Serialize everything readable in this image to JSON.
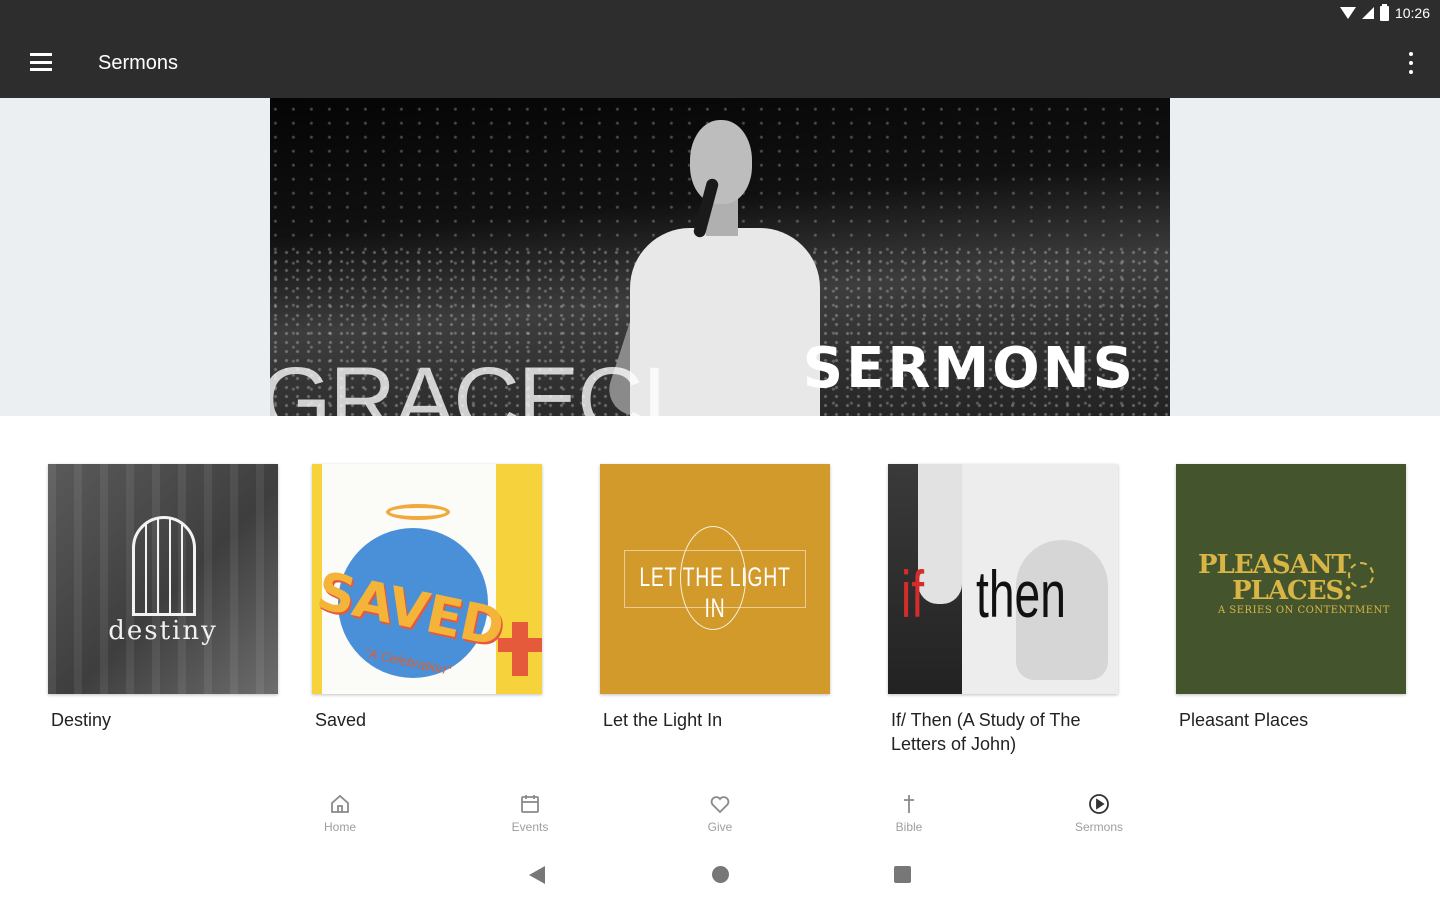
{
  "status_bar": {
    "time": "10:26",
    "icons": [
      "wifi-icon",
      "signal-icon",
      "battery-icon"
    ]
  },
  "app_bar": {
    "title": "Sermons",
    "left_icon": "menu-icon",
    "right_icon": "more-vert-icon",
    "background": "#2d2d2d"
  },
  "hero": {
    "label": "SERMONS",
    "background_text": "GRACECI"
  },
  "series": [
    {
      "title": "Destiny",
      "art_text": "destiny"
    },
    {
      "title": "Saved",
      "art_text": "SAVED",
      "art_subtext": "\"A Celebration\""
    },
    {
      "title": "Let the Light In",
      "art_text": "LET THE LIGHT IN"
    },
    {
      "title": "If/ Then (A Study of The Letters of John)",
      "art_text_1": "if",
      "art_text_2": "then"
    },
    {
      "title": "Pleasant Places",
      "art_text_1": "PLEASANT",
      "art_text_2": "PLACES:",
      "art_text_3": "A SERIES ON CONTENTMENT"
    }
  ],
  "bottom_nav": {
    "items": [
      {
        "label": "Home",
        "icon": "home-icon"
      },
      {
        "label": "Events",
        "icon": "calendar-icon"
      },
      {
        "label": "Give",
        "icon": "heart-icon"
      },
      {
        "label": "Bible",
        "icon": "cross-icon"
      },
      {
        "label": "Sermons",
        "icon": "play-circle-icon"
      }
    ]
  },
  "system_nav": {
    "buttons": [
      "back-icon",
      "home-circle-icon",
      "recent-apps-icon"
    ]
  }
}
